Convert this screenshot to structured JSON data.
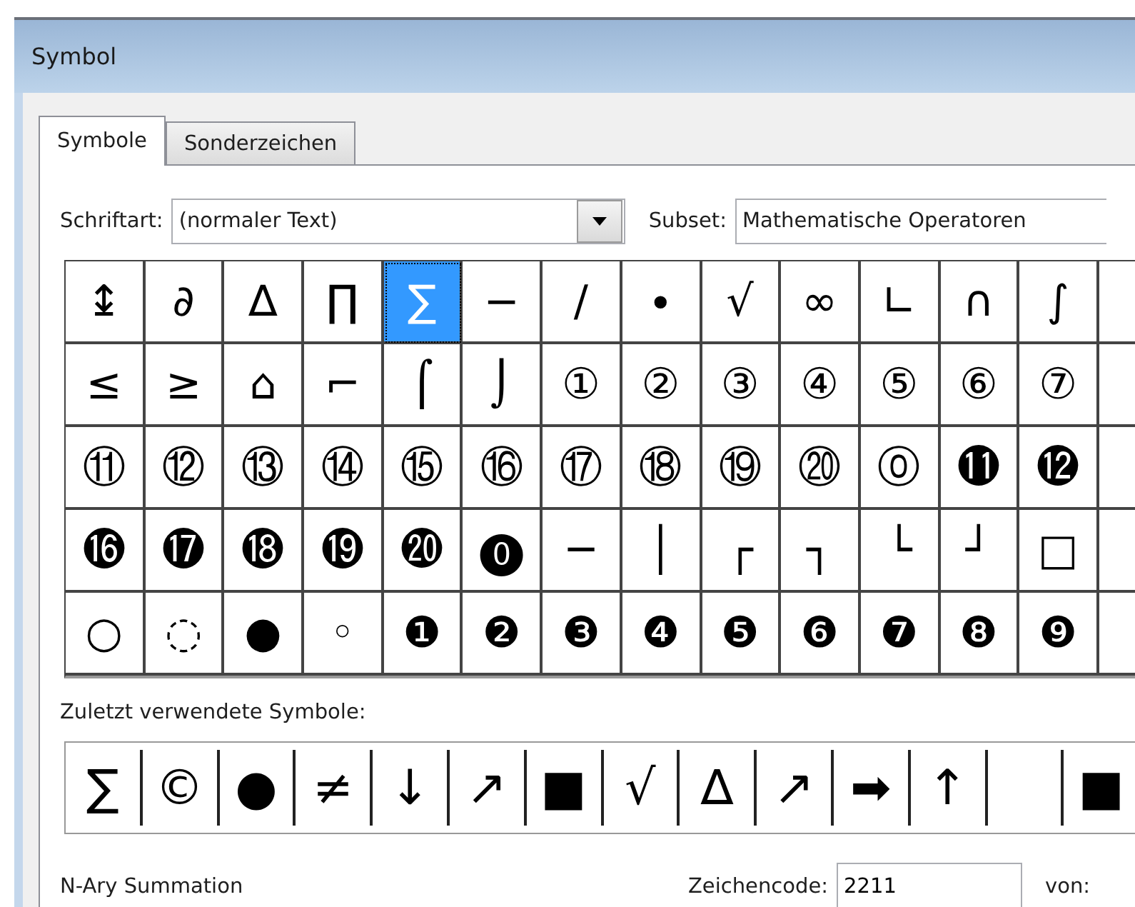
{
  "window": {
    "title": "Symbol"
  },
  "tabs": [
    {
      "label": "Symbole",
      "selected": true
    },
    {
      "label": "Sonderzeichen",
      "selected": false
    }
  ],
  "font": {
    "label": "Schriftart:",
    "value": "(normaler Text)"
  },
  "subset": {
    "label": "Subset:",
    "value": "Mathematische Operatoren"
  },
  "symbols": [
    {
      "char": "↨",
      "selected": false
    },
    {
      "char": "∂",
      "selected": false
    },
    {
      "char": "∆",
      "selected": false
    },
    {
      "char": "∏",
      "selected": false
    },
    {
      "char": "∑",
      "selected": true
    },
    {
      "char": "−",
      "selected": false
    },
    {
      "char": "∕",
      "selected": false
    },
    {
      "char": "∙",
      "selected": false
    },
    {
      "char": "√",
      "selected": false
    },
    {
      "char": "∞",
      "selected": false
    },
    {
      "char": "∟",
      "selected": false
    },
    {
      "char": "∩",
      "selected": false
    },
    {
      "char": "∫",
      "selected": false
    },
    {
      "selected": false
    },
    {
      "char": "≤",
      "selected": false
    },
    {
      "char": "≥",
      "selected": false
    },
    {
      "char": "⌂",
      "selected": false
    },
    {
      "char": "⌐",
      "selected": false
    },
    {
      "char": "⌠",
      "selected": false
    },
    {
      "char": "⌡",
      "selected": false
    },
    {
      "char": "①",
      "selected": false
    },
    {
      "char": "②",
      "selected": false
    },
    {
      "char": "③",
      "selected": false
    },
    {
      "char": "④",
      "selected": false
    },
    {
      "char": "⑤",
      "selected": false
    },
    {
      "char": "⑥",
      "selected": false
    },
    {
      "char": "⑦",
      "selected": false
    },
    {
      "selected": false
    },
    {
      "char": "⑪",
      "selected": false
    },
    {
      "char": "⑫",
      "selected": false
    },
    {
      "char": "⑬",
      "selected": false
    },
    {
      "char": "⑭",
      "selected": false
    },
    {
      "char": "⑮",
      "selected": false
    },
    {
      "char": "⑯",
      "selected": false
    },
    {
      "char": "⑰",
      "selected": false
    },
    {
      "char": "⑱",
      "selected": false
    },
    {
      "char": "⑲",
      "selected": false
    },
    {
      "char": "⑳",
      "selected": false
    },
    {
      "char": "⓪",
      "selected": false
    },
    {
      "char": "⓫",
      "selected": false
    },
    {
      "char": "⓬",
      "selected": false
    },
    {
      "selected": false
    },
    {
      "char": "⓰",
      "selected": false
    },
    {
      "char": "⓱",
      "selected": false
    },
    {
      "char": "⓲",
      "selected": false
    },
    {
      "char": "⓳",
      "selected": false
    },
    {
      "char": "⓴",
      "selected": false
    },
    {
      "char": "⓿",
      "selected": false
    },
    {
      "char": "─",
      "selected": false
    },
    {
      "char": "│",
      "selected": false
    },
    {
      "char": "┌",
      "selected": false
    },
    {
      "char": "┐",
      "selected": false
    },
    {
      "char": "└",
      "selected": false
    },
    {
      "char": "┘",
      "selected": false
    },
    {
      "char": "□",
      "selected": false
    },
    {
      "selected": false
    },
    {
      "char": "○",
      "selected": false
    },
    {
      "char": "◌",
      "selected": false
    },
    {
      "char": "●",
      "selected": false
    },
    {
      "char": "◦",
      "selected": false
    },
    {
      "char": "❶",
      "selected": false
    },
    {
      "char": "❷",
      "selected": false
    },
    {
      "char": "❸",
      "selected": false
    },
    {
      "char": "❹",
      "selected": false
    },
    {
      "char": "❺",
      "selected": false
    },
    {
      "char": "❻",
      "selected": false
    },
    {
      "char": "❼",
      "selected": false
    },
    {
      "char": "❽",
      "selected": false
    },
    {
      "char": "❾",
      "selected": false
    },
    {
      "selected": false
    }
  ],
  "recent": {
    "label": "Zuletzt verwendete Symbole:",
    "items": [
      {
        "kind": "char",
        "char": "∑"
      },
      {
        "kind": "char",
        "char": "©"
      },
      {
        "kind": "char",
        "char": "●"
      },
      {
        "kind": "char",
        "char": "≠"
      },
      {
        "kind": "char",
        "char": "↓"
      },
      {
        "kind": "char",
        "char": "↗"
      },
      {
        "kind": "char",
        "char": "■"
      },
      {
        "kind": "char",
        "char": "√"
      },
      {
        "kind": "char",
        "char": "∆"
      },
      {
        "kind": "char",
        "char": "↗"
      },
      {
        "kind": "char",
        "char": "➡"
      },
      {
        "kind": "char",
        "char": "↑"
      },
      {
        "kind": "blank"
      },
      {
        "kind": "char",
        "char": "■"
      }
    ]
  },
  "status": {
    "name": "N-Ary Summation"
  },
  "char_code": {
    "label": "Zeichencode:",
    "value": "2211"
  },
  "from": {
    "label": "von:"
  }
}
